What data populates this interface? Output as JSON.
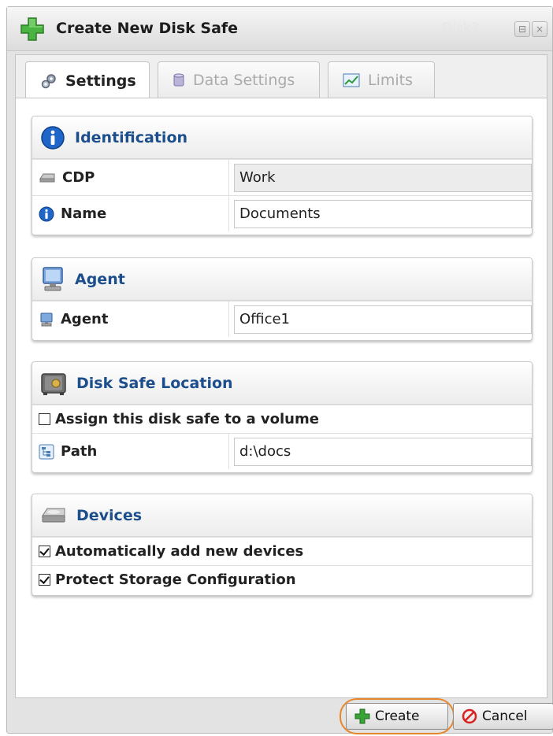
{
  "window": {
    "title": "Create New Disk Safe",
    "ghost_title": "Disk3"
  },
  "tabs": [
    {
      "label": "Settings",
      "icon": "gears-icon",
      "active": true
    },
    {
      "label": "Data Settings",
      "icon": "database-icon",
      "active": false
    },
    {
      "label": "Limits",
      "icon": "chart-icon",
      "active": false
    }
  ],
  "identification": {
    "title": "Identification",
    "cdp_label": "CDP",
    "cdp_value": "Work",
    "name_label": "Name",
    "name_value": "Documents"
  },
  "agent": {
    "title": "Agent",
    "agent_label": "Agent",
    "agent_value": "Office1"
  },
  "location": {
    "title": "Disk Safe Location",
    "assign_label": "Assign this disk safe to a volume",
    "assign_checked": false,
    "path_label": "Path",
    "path_value": "d:\\docs"
  },
  "devices": {
    "title": "Devices",
    "auto_add_label": "Automatically add new devices",
    "auto_add_checked": true,
    "protect_label": "Protect Storage Configuration",
    "protect_checked": true
  },
  "footer": {
    "create_label": "Create",
    "cancel_label": "Cancel"
  },
  "colors": {
    "panel_title": "#1d4e8c",
    "highlight": "#e6862a",
    "create_icon": "#3aa335",
    "cancel_icon": "#d9211f"
  }
}
